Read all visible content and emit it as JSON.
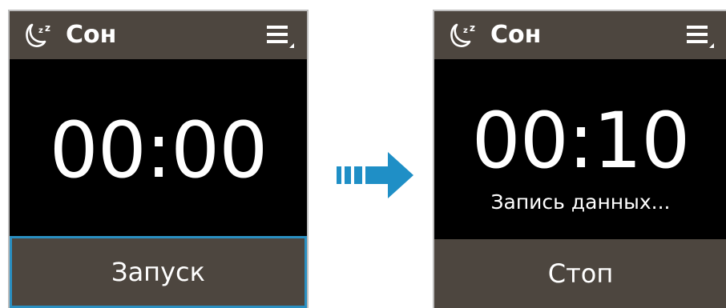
{
  "left_screen": {
    "app_title": "Сон",
    "app_icon": "sleep-moon-icon",
    "menu_icon": "menu-icon",
    "timer": "00:00",
    "button_label": "Запуск"
  },
  "arrow_icon": "right-arrow-icon",
  "right_screen": {
    "app_title": "Сон",
    "app_icon": "sleep-moon-icon",
    "menu_icon": "menu-icon",
    "timer": "00:10",
    "status": "Запись данных...",
    "button_label": "Стоп"
  },
  "colors": {
    "header": "#4d463f",
    "button": "#4d463f",
    "screen_bg": "#000000",
    "highlight": "#2a8fc1",
    "arrow": "#1f8fc6"
  }
}
